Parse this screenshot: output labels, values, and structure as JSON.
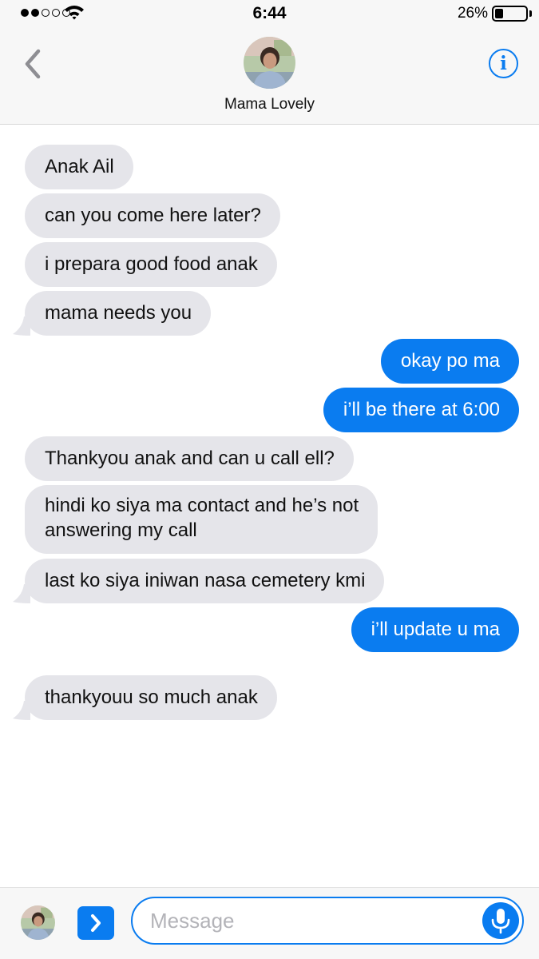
{
  "status_bar": {
    "time": "6:44",
    "battery_percent": "26%",
    "battery_level": 0.26,
    "signal_bars_filled": 2,
    "signal_bars_total": 5
  },
  "header": {
    "contact_name": "Mama Lovely",
    "info_glyph": "i",
    "icons": {
      "back": "chevron-left-icon",
      "info": "info-icon"
    }
  },
  "messages": [
    {
      "direction": "incoming",
      "text": "Anak Ail"
    },
    {
      "direction": "incoming",
      "text": "can you come here later?"
    },
    {
      "direction": "incoming",
      "text": "i prepara good food anak"
    },
    {
      "direction": "incoming",
      "text": "mama needs you"
    },
    {
      "direction": "outgoing",
      "text": "okay po ma"
    },
    {
      "direction": "outgoing",
      "text": "i’ll be there at 6:00"
    },
    {
      "direction": "incoming",
      "text": "Thankyou anak and can u call ell?"
    },
    {
      "direction": "incoming",
      "text": "hindi ko siya ma contact and he’s not answering my call",
      "lines": [
        "hindi ko siya ma contact and he’s not",
        "answering my call"
      ]
    },
    {
      "direction": "incoming",
      "text": "last ko siya iniwan nasa cemetery kmi"
    },
    {
      "direction": "outgoing",
      "text": "i’ll update u ma"
    },
    {
      "direction": "incoming",
      "text": "thankyouu so much anak"
    }
  ],
  "composer": {
    "placeholder": "Message",
    "value": "",
    "icons": {
      "apps": "chevron-right-icon",
      "mic": "microphone-icon"
    }
  },
  "colors": {
    "accent_blue": "#0a7cf0",
    "incoming_bubble": "#e5e5ea",
    "bar_background": "#f7f7f7"
  }
}
